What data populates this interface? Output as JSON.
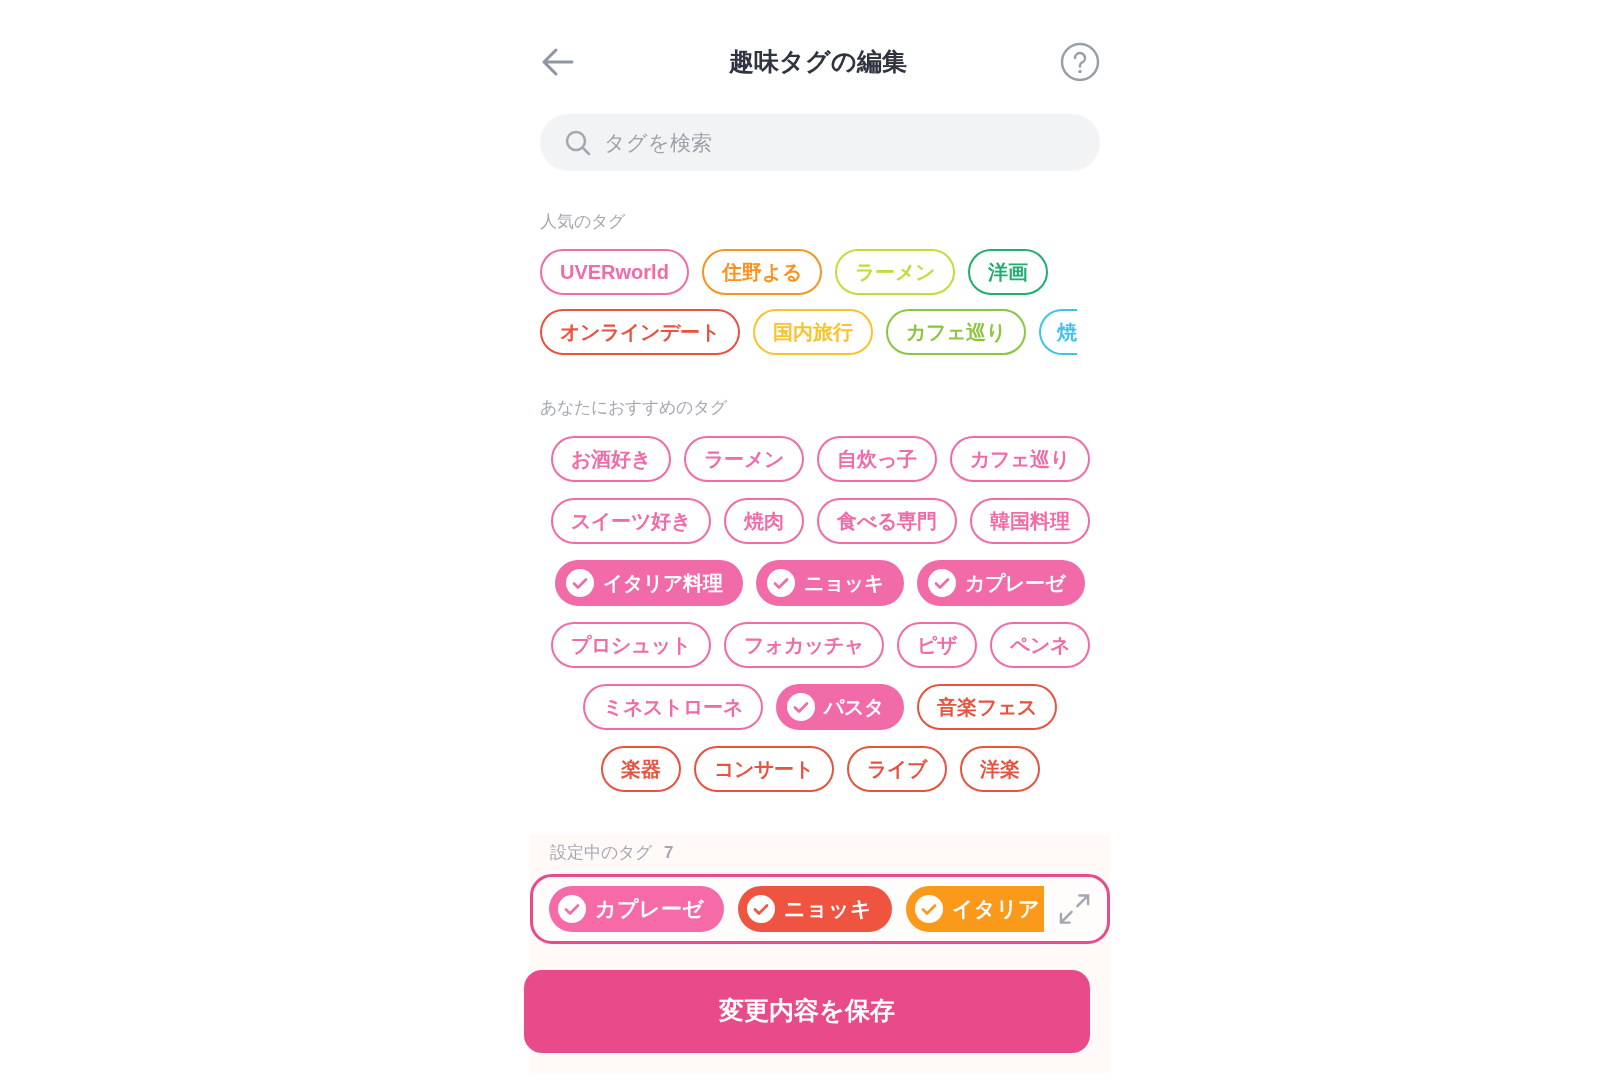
{
  "header": {
    "title": "趣味タグの編集"
  },
  "search": {
    "placeholder": "タグを検索"
  },
  "popular": {
    "label": "人気のタグ",
    "rows": [
      [
        {
          "label": "UVERworld",
          "color": "#f06ba8",
          "selected": false
        },
        {
          "label": "住野よる",
          "color": "#f7931e",
          "selected": false
        },
        {
          "label": "ラーメン",
          "color": "#c8d93a",
          "selected": false
        },
        {
          "label": "洋画",
          "color": "#1fae6e",
          "selected": false
        }
      ],
      [
        {
          "label": "オンラインデート",
          "color": "#e8533f",
          "selected": false
        },
        {
          "label": "国内旅行",
          "color": "#f9c22e",
          "selected": false
        },
        {
          "label": "カフェ巡り",
          "color": "#8cc63f",
          "selected": false
        },
        {
          "label": "焼",
          "color": "#3cc4e8",
          "selected": false,
          "clipped": true
        }
      ]
    ]
  },
  "recommended": {
    "label": "あなたにおすすめのタグ",
    "rows": [
      [
        {
          "label": "お酒好き",
          "color": "#f06ba8",
          "selected": false
        },
        {
          "label": "ラーメン",
          "color": "#f06ba8",
          "selected": false
        },
        {
          "label": "自炊っ子",
          "color": "#f06ba8",
          "selected": false
        },
        {
          "label": "カフェ巡り",
          "color": "#f06ba8",
          "selected": false
        }
      ],
      [
        {
          "label": "スイーツ好き",
          "color": "#f06ba8",
          "selected": false
        },
        {
          "label": "焼肉",
          "color": "#f06ba8",
          "selected": false
        },
        {
          "label": "食べる専門",
          "color": "#f06ba8",
          "selected": false
        },
        {
          "label": "韓国料理",
          "color": "#f06ba8",
          "selected": false
        }
      ],
      [
        {
          "label": "イタリア料理",
          "color": "#f06ba8",
          "selected": true
        },
        {
          "label": "ニョッキ",
          "color": "#f06ba8",
          "selected": true
        },
        {
          "label": "カプレーゼ",
          "color": "#f06ba8",
          "selected": true
        }
      ],
      [
        {
          "label": "プロシュット",
          "color": "#f06ba8",
          "selected": false
        },
        {
          "label": "フォカッチャ",
          "color": "#f06ba8",
          "selected": false
        },
        {
          "label": "ピザ",
          "color": "#f06ba8",
          "selected": false
        },
        {
          "label": "ペンネ",
          "color": "#f06ba8",
          "selected": false
        }
      ],
      [
        {
          "label": "ミネストローネ",
          "color": "#f06ba8",
          "selected": false
        },
        {
          "label": "パスタ",
          "color": "#f06ba8",
          "selected": true
        },
        {
          "label": "音楽フェス",
          "color": "#e8533f",
          "selected": false
        }
      ],
      [
        {
          "label": "楽器",
          "color": "#e8533f",
          "selected": false
        },
        {
          "label": "コンサート",
          "color": "#e8533f",
          "selected": false
        },
        {
          "label": "ライブ",
          "color": "#e8533f",
          "selected": false
        },
        {
          "label": "洋楽",
          "color": "#e8533f",
          "selected": false
        }
      ]
    ]
  },
  "current": {
    "label": "設定中のタグ",
    "count": "7",
    "tags": [
      {
        "label": "カプレーゼ",
        "color": "#f76aa8"
      },
      {
        "label": "ニョッキ",
        "color": "#ee5440"
      },
      {
        "label": "イタリア",
        "color": "#fb9a1a",
        "clipped": true
      }
    ]
  },
  "save_button": "変更内容を保存"
}
